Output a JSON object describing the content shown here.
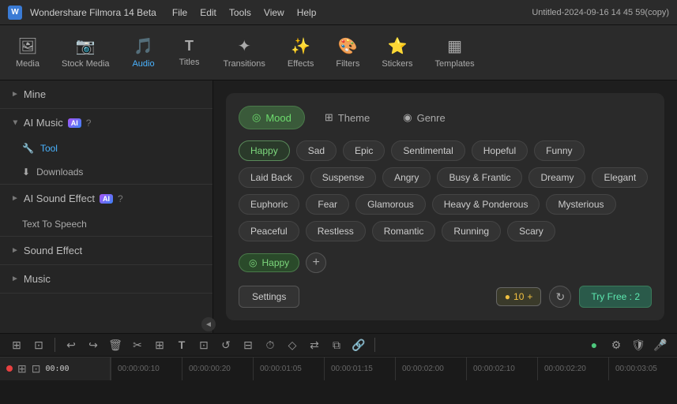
{
  "titlebar": {
    "app_name": "Wondershare Filmora 14 Beta",
    "menus": [
      "File",
      "Edit",
      "Tools",
      "View",
      "Help"
    ],
    "title": "Untitled-2024-09-16 14 45 59(copy)"
  },
  "toolbar": {
    "items": [
      {
        "id": "media",
        "label": "Media",
        "icon": "🖼"
      },
      {
        "id": "stock_media",
        "label": "Stock Media",
        "icon": "📷"
      },
      {
        "id": "audio",
        "label": "Audio",
        "icon": "🎵",
        "active": true
      },
      {
        "id": "titles",
        "label": "Titles",
        "icon": "T"
      },
      {
        "id": "transitions",
        "label": "Transitions",
        "icon": "✦"
      },
      {
        "id": "effects",
        "label": "Effects",
        "icon": "✨"
      },
      {
        "id": "filters",
        "label": "Filters",
        "icon": "🎨"
      },
      {
        "id": "stickers",
        "label": "Stickers",
        "icon": "⭐"
      },
      {
        "id": "templates",
        "label": "Templates",
        "icon": "▦"
      }
    ]
  },
  "sidebar": {
    "sections": [
      {
        "id": "mine",
        "label": "Mine",
        "collapsed": true,
        "chevron": "►"
      },
      {
        "id": "ai_music",
        "label": "AI Music",
        "collapsed": false,
        "chevron": "▼",
        "has_ai": true,
        "items": [
          {
            "id": "tool",
            "label": "Tool",
            "icon": "🔧",
            "active": true
          },
          {
            "id": "downloads",
            "label": "Downloads",
            "icon": "⬇"
          }
        ]
      },
      {
        "id": "ai_sound_effect",
        "label": "AI Sound Effect",
        "collapsed": true,
        "chevron": "►",
        "has_ai": true,
        "items": [
          {
            "id": "text_to_speech",
            "label": "Text To Speech",
            "icon": ""
          }
        ]
      },
      {
        "id": "sound_effect",
        "label": "Sound Effect",
        "collapsed": true,
        "chevron": "►"
      },
      {
        "id": "music",
        "label": "Music",
        "collapsed": true,
        "chevron": "►"
      }
    ]
  },
  "panel": {
    "tabs": [
      {
        "id": "mood",
        "label": "Mood",
        "icon": "◎",
        "active": true
      },
      {
        "id": "theme",
        "label": "Theme",
        "icon": "⊞",
        "active": false
      },
      {
        "id": "genre",
        "label": "Genre",
        "icon": "◉",
        "active": false
      }
    ],
    "mood_tags": [
      {
        "id": "happy",
        "label": "Happy",
        "selected": true
      },
      {
        "id": "sad",
        "label": "Sad",
        "selected": false
      },
      {
        "id": "epic",
        "label": "Epic",
        "selected": false
      },
      {
        "id": "sentimental",
        "label": "Sentimental",
        "selected": false
      },
      {
        "id": "hopeful",
        "label": "Hopeful",
        "selected": false
      },
      {
        "id": "funny",
        "label": "Funny",
        "selected": false
      },
      {
        "id": "laid_back",
        "label": "Laid Back",
        "selected": false
      },
      {
        "id": "suspense",
        "label": "Suspense",
        "selected": false
      },
      {
        "id": "angry",
        "label": "Angry",
        "selected": false
      },
      {
        "id": "busy_frantic",
        "label": "Busy & Frantic",
        "selected": false
      },
      {
        "id": "dreamy",
        "label": "Dreamy",
        "selected": false
      },
      {
        "id": "elegant",
        "label": "Elegant",
        "selected": false
      },
      {
        "id": "euphoric",
        "label": "Euphoric",
        "selected": false
      },
      {
        "id": "fear",
        "label": "Fear",
        "selected": false
      },
      {
        "id": "glamorous",
        "label": "Glamorous",
        "selected": false
      },
      {
        "id": "heavy_ponderous",
        "label": "Heavy & Ponderous",
        "selected": false
      },
      {
        "id": "mysterious",
        "label": "Mysterious",
        "selected": false
      },
      {
        "id": "peaceful",
        "label": "Peaceful",
        "selected": false
      },
      {
        "id": "restless",
        "label": "Restless",
        "selected": false
      },
      {
        "id": "romantic",
        "label": "Romantic",
        "selected": false
      },
      {
        "id": "running",
        "label": "Running",
        "selected": false
      },
      {
        "id": "scary",
        "label": "Scary",
        "selected": false
      }
    ],
    "selected_tag": "Happy",
    "settings_label": "Settings",
    "duration_value": "10",
    "duration_plus": "+",
    "try_free_label": "Try Free : 2"
  },
  "bottom_toolbar": {
    "icons": [
      "⊞",
      "⊡",
      "↩",
      "↪",
      "🗑",
      "✂",
      "⊞",
      "T",
      "⊡",
      "↺",
      "⊟",
      "⏱",
      "◇",
      "⇄",
      "⧉",
      "🔗",
      "●",
      "⚙",
      "🛡",
      "🎤"
    ]
  },
  "timeline": {
    "time_display": "00:00",
    "marks": [
      "00:00:00:10",
      "00:00:00:20",
      "00:00:01:05",
      "00:00:01:15",
      "00:00:02:00",
      "00:00:02:10",
      "00:00:02:20",
      "00:00:03:05"
    ]
  }
}
